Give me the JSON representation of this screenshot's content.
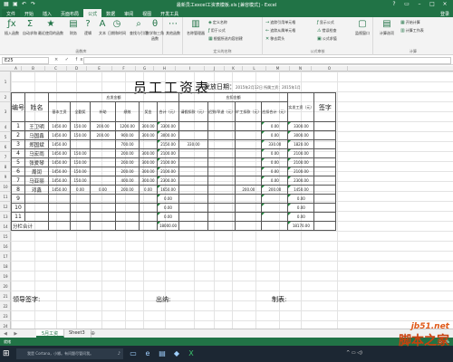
{
  "window": {
    "title": "最新员工excel工资表模板.xls [兼容模式] - Excel",
    "login": "登录"
  },
  "ribbon_tabs": [
    "文件",
    "开始",
    "插入",
    "页面布局",
    "公式",
    "数据",
    "审阅",
    "视图",
    "开发工具"
  ],
  "ribbon": {
    "insert_function": "插入函数",
    "autosum": "自动求和",
    "recent": "最近使用的函数",
    "financial": "财务",
    "logical": "逻辑",
    "text": "文本",
    "datetime": "日期和时间",
    "lookup": "查找与引用",
    "math": "数学和三角函数",
    "more": "其他函数",
    "group_library": "函数库",
    "name_manager": "名称管理器",
    "define_name": "定义名称",
    "use_in_formula": "用于公式",
    "create_from_selection": "根据所选内容创建",
    "group_names": "定义的名称",
    "trace_precedents": "追踪引用单元格",
    "trace_dependents": "追踪从属单元格",
    "remove_arrows": "移去箭头",
    "show_formulas": "显示公式",
    "error_checking": "错误检查",
    "evaluate_formula": "公式求值",
    "group_audit": "公式审核",
    "watch_window": "监视窗口",
    "calc_options": "计算选项",
    "calc_now": "开始计算",
    "calc_sheet": "计算工作表",
    "group_calc": "计算"
  },
  "formula_bar": {
    "name_box": "E25",
    "icons": "× ✓ fx",
    "content": ""
  },
  "column_headers": [
    "A",
    "B",
    "C",
    "D",
    "E",
    "F",
    "G",
    "H",
    "I",
    "J",
    "K",
    "L",
    "M",
    "N",
    "O"
  ],
  "row_headers": [
    "1",
    "2",
    "3",
    "4",
    "5",
    "6",
    "7",
    "8",
    "9",
    "10",
    "11",
    "12",
    "13",
    "14",
    "15",
    "16",
    "17",
    "18",
    "19",
    "20",
    "21",
    "22",
    "23",
    "24",
    "25",
    "26"
  ],
  "sheet": {
    "title": "员工工资表",
    "date_label": "发放日期：",
    "date_value": "2015年2月12日 所属工资：2015年1月",
    "headers": {
      "num": "编号",
      "name": "姓名",
      "payable": "应发金额",
      "base": "基本工资",
      "allowance": "全勤奖",
      "subsidy": "补助",
      "performance": "绩效",
      "bonus": "奖金",
      "total": "合计（元）",
      "deduct": "应扣金额",
      "absence": "请假扣款（元）",
      "late": "迟到/早退（元）",
      "absent": "旷工扣款（元）",
      "deduct_total": "应扣合计（元）",
      "actual": "实发工资（元）",
      "signature": "签字"
    },
    "rows": [
      {
        "id": "1",
        "name": "王卫明",
        "base": "1450.00",
        "allowance": "150.00",
        "subsidy": "200.00",
        "performance": "1200.00",
        "bonus": "300.00",
        "total": "3300.00",
        "absence": "",
        "late": "",
        "absent": "",
        "deduct_total": "0.00",
        "actual": "3300.00"
      },
      {
        "id": "2",
        "name": "马国鑫",
        "base": "1450.00",
        "allowance": "150.00",
        "subsidy": "200.00",
        "performance": "900.00",
        "bonus": "300.00",
        "total": "3000.00",
        "absence": "",
        "late": "",
        "absent": "",
        "deduct_total": "0.00",
        "actual": "3000.00"
      },
      {
        "id": "3",
        "name": "郑国斌",
        "base": "1450.00",
        "allowance": "",
        "subsidy": "",
        "performance": "700.00",
        "bonus": "",
        "total": "2150.00",
        "absence": "330.00",
        "late": "",
        "absent": "",
        "deduct_total": "330.00",
        "actual": "1820.00"
      },
      {
        "id": "4",
        "name": "马宏雨",
        "base": "1450.00",
        "allowance": "150.00",
        "subsidy": "",
        "performance": "200.00",
        "bonus": "300.00",
        "total": "2100.00",
        "absence": "",
        "late": "",
        "absent": "",
        "deduct_total": "0.00",
        "actual": "2100.00"
      },
      {
        "id": "5",
        "name": "张爱琴",
        "base": "1450.00",
        "allowance": "150.00",
        "subsidy": "",
        "performance": "200.00",
        "bonus": "300.00",
        "total": "2100.00",
        "absence": "",
        "late": "",
        "absent": "",
        "deduct_total": "0.00",
        "actual": "2100.00"
      },
      {
        "id": "6",
        "name": "周闰",
        "base": "1450.00",
        "allowance": "150.00",
        "subsidy": "",
        "performance": "200.00",
        "bonus": "300.00",
        "total": "2100.00",
        "absence": "",
        "late": "",
        "absent": "",
        "deduct_total": "0.00",
        "actual": "2100.00"
      },
      {
        "id": "7",
        "name": "马亚丽",
        "base": "1450.00",
        "allowance": "150.00",
        "subsidy": "",
        "performance": "400.00",
        "bonus": "300.00",
        "total": "2300.00",
        "absence": "",
        "late": "",
        "absent": "",
        "deduct_total": "0.00",
        "actual": "2300.00"
      },
      {
        "id": "8",
        "name": "邓鑫",
        "base": "1450.00",
        "allowance": "0.00",
        "subsidy": "0.00",
        "performance": "200.00",
        "bonus": "0.00",
        "total": "1650.00",
        "absence": "",
        "late": "",
        "absent": "200.00",
        "deduct_total": "200.00",
        "actual": "1450.00"
      },
      {
        "id": "9",
        "name": "",
        "base": "",
        "allowance": "",
        "subsidy": "",
        "performance": "",
        "bonus": "",
        "total": "0.00",
        "absence": "",
        "late": "",
        "absent": "",
        "deduct_total": "",
        "actual": "0.00"
      },
      {
        "id": "10",
        "name": "",
        "base": "",
        "allowance": "",
        "subsidy": "",
        "performance": "",
        "bonus": "",
        "total": "0.00",
        "absence": "",
        "late": "",
        "absent": "",
        "deduct_total": "",
        "actual": "0.00"
      },
      {
        "id": "11",
        "name": "",
        "base": "",
        "allowance": "",
        "subsidy": "",
        "performance": "",
        "bonus": "",
        "total": "0.00",
        "absence": "",
        "late": "",
        "absent": "",
        "deduct_total": "",
        "actual": "0.00"
      }
    ],
    "subtotal_label": "分栏合计",
    "subtotal_total": "18000.00",
    "subtotal_actual": "18170.00",
    "leader_sign": "领导签字:",
    "cashier": "出纳:",
    "preparer": "制表:"
  },
  "sheet_tabs": [
    "5月工资",
    "Sheet3"
  ],
  "status": {
    "ready": "就绪",
    "zoom": "100%"
  },
  "taskbar": {
    "cortana_text": "我是 Cortana，小娜。有问题尽管问我。"
  },
  "watermark": {
    "url": "jb51.net",
    "site": "脚本之家"
  }
}
